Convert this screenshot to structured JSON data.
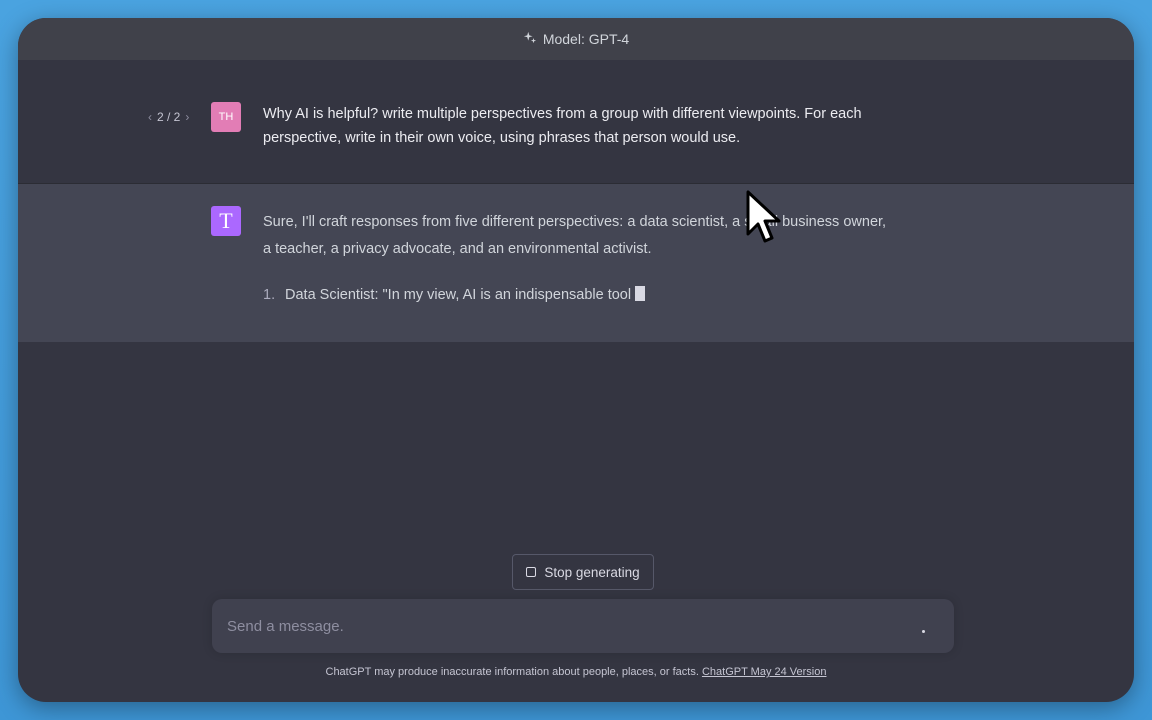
{
  "header": {
    "model_label": "Model: GPT-4"
  },
  "conversation": {
    "user": {
      "pager": {
        "current": "2 / 2",
        "prev": "‹",
        "next": "›"
      },
      "avatar_initials": "TH",
      "message": "Why AI is helpful? write multiple perspectives from a group with different viewpoints. For each perspective, write in their own voice, using phrases that person would use."
    },
    "assistant": {
      "avatar_letter": "T",
      "intro": "Sure, I'll craft responses from five different perspectives: a data scientist, a small business owner, a teacher, a privacy advocate, and an environmental activist.",
      "list": [
        {
          "num": "1.",
          "text": "Data Scientist: \"In my view, AI is an indispensable tool"
        }
      ]
    }
  },
  "controls": {
    "stop_label": "Stop generating",
    "input_placeholder": "Send a message.",
    "input_value": ""
  },
  "footer": {
    "disclaimer": "ChatGPT may produce inaccurate information about people, places, or facts.",
    "version_link": "ChatGPT May 24 Version"
  },
  "colors": {
    "background": "#343541",
    "assistant_row": "#444654",
    "user_avatar": "#e27db5",
    "bot_avatar": "#ab68ff"
  },
  "icons": [
    "sparkle-icon",
    "stop-icon",
    "mouse-pointer-icon"
  ]
}
